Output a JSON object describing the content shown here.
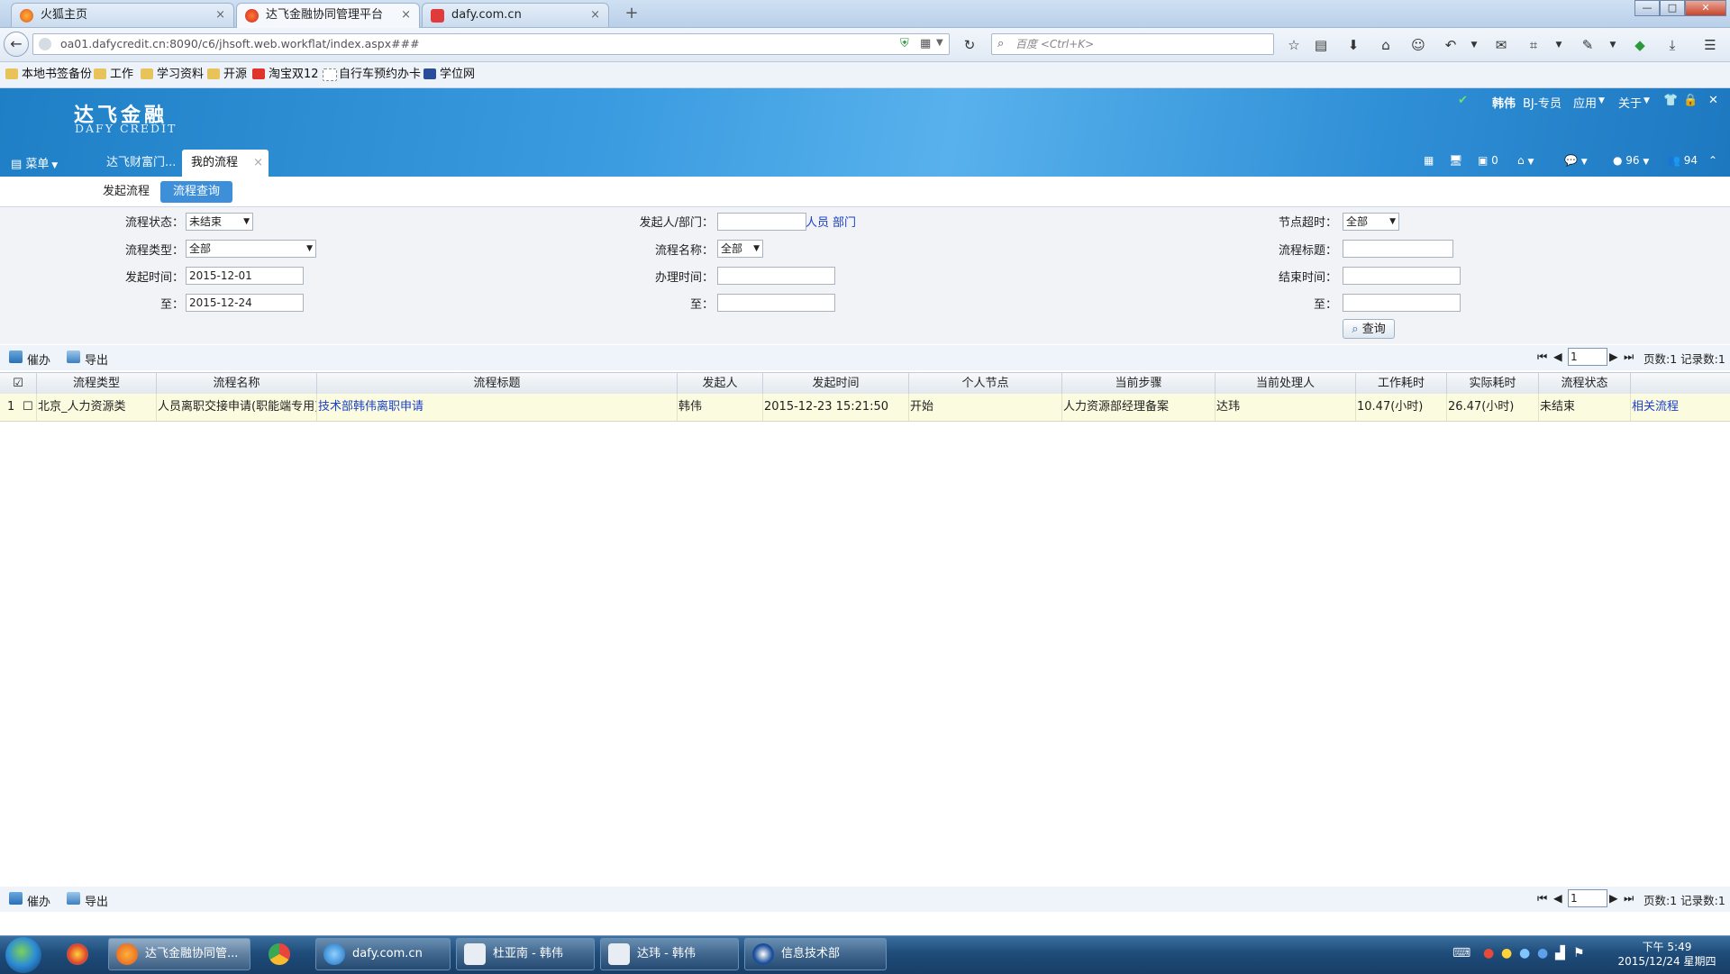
{
  "browser": {
    "tabs": [
      {
        "label": "火狐主页",
        "icon": "firefox-icon"
      },
      {
        "label": "达飞金融协同管理平台",
        "icon": "dafy-icon"
      },
      {
        "label": "dafy.com.cn",
        "icon": "mail-icon"
      }
    ],
    "active_tab": 1,
    "url": "oa01.dafycredit.cn:8090/c6/jhsoft.web.workflat/index.aspx###",
    "search_placeholder": "百度 <Ctrl+K>",
    "bookmarks": [
      {
        "label": "本地书签备份",
        "icon": "folder-icon"
      },
      {
        "label": "工作",
        "icon": "folder-icon"
      },
      {
        "label": "学习资料",
        "icon": "folder-icon"
      },
      {
        "label": "开源",
        "icon": "folder-icon"
      },
      {
        "label": "淘宝双12",
        "icon": "taobao-icon"
      },
      {
        "label": "自行车预约办卡",
        "icon": "page-icon"
      },
      {
        "label": "学位网",
        "icon": "degree-icon"
      }
    ]
  },
  "app": {
    "logo_cn": "达飞金融",
    "logo_en": "DAFY CREDIT",
    "user_name": "韩伟",
    "user_role": "BJ-专员",
    "menu_apps": "应用",
    "menu_about": "关于",
    "menu_label": "菜单",
    "tabs": [
      "达飞财富门...",
      "我的流程"
    ],
    "active_tab": 1,
    "count_messages": "0",
    "count_reminders": "96",
    "count_users": "94",
    "sub_tabs": [
      "发起流程",
      "流程查询"
    ],
    "active_sub_tab": 1
  },
  "filter": {
    "status_label": "流程状态：",
    "status_value": "未结束",
    "initiator_label": "发起人/部门：",
    "initiator_value": "",
    "link_person": "人员",
    "link_dept": "部门",
    "node_overtime_label": "节点超时：",
    "node_overtime_value": "全部",
    "type_label": "流程类型：",
    "type_value": "全部",
    "name_label": "流程名称：",
    "name_value": "全部",
    "title_label": "流程标题：",
    "title_value": "",
    "start_time_label": "发起时间：",
    "start_time_from": "2015-12-01",
    "handle_time_label": "办理时间：",
    "handle_time_from": "",
    "end_time_label": "结束时间：",
    "end_time_from": "",
    "to_label": "至：",
    "start_time_to": "2015-12-24",
    "handle_time_to": "",
    "end_time_to": "",
    "search_button": "查询"
  },
  "toolbar": {
    "urge_label": "催办",
    "export_label": "导出",
    "page_value": "1",
    "page_info": "页数:1 记录数:1"
  },
  "grid": {
    "columns": [
      "流程类型",
      "流程名称",
      "流程标题",
      "发起人",
      "发起时间",
      "个人节点",
      "当前步骤",
      "当前处理人",
      "工作耗时",
      "实际耗时",
      "流程状态",
      ""
    ],
    "rows": [
      {
        "index": "1",
        "type": "北京_人力资源类",
        "name": "人员离职交接申请(职能端专用)",
        "title": "技术部韩伟离职申请",
        "initiator": "韩伟",
        "start_time": "2015-12-23 15:21:50",
        "personal_node": "开始",
        "current_step": "人力资源部经理备案",
        "current_handler": "达玮",
        "work_time": "10.47(小时)",
        "actual_time": "26.47(小时)",
        "status": "未结束",
        "related": "相关流程"
      }
    ]
  },
  "taskbar": {
    "apps": [
      {
        "label": "达飞金融协同管...",
        "icon": "firefox-icon"
      },
      {
        "label": "dafy.com.cn",
        "icon": "ie-icon"
      },
      {
        "label": "杜亚南 - 韩伟",
        "icon": "chat-icon"
      },
      {
        "label": "达玮 - 韩伟",
        "icon": "chat-icon"
      },
      {
        "label": "信息技术部",
        "icon": "app-icon"
      }
    ],
    "time": "下午 5:49",
    "date": "2015/12/24 星期四"
  },
  "colors": {
    "header_blue": "#2f8fd6",
    "link_blue": "#1a3fc8",
    "row_highlight": "#fbfbe0",
    "active_subtab": "#3d8fd9"
  }
}
